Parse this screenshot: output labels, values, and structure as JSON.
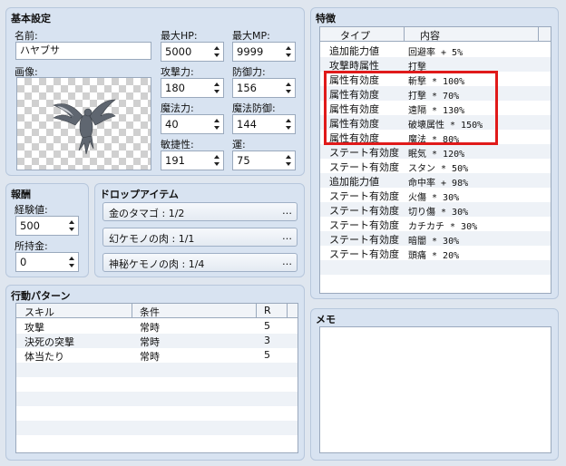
{
  "basic": {
    "title": "基本設定",
    "name_label": "名前:",
    "name_value": "ハヤブサ",
    "image_label": "画像:",
    "hp_label": "最大HP:",
    "hp_value": "5000",
    "mp_label": "最大MP:",
    "mp_value": "9999",
    "atk_label": "攻撃力:",
    "atk_value": "180",
    "def_label": "防御力:",
    "def_value": "156",
    "mat_label": "魔法力:",
    "mat_value": "40",
    "mdf_label": "魔法防御:",
    "mdf_value": "144",
    "agi_label": "敏捷性:",
    "agi_value": "191",
    "luk_label": "運:",
    "luk_value": "75"
  },
  "reward": {
    "title": "報酬",
    "exp_label": "経験値:",
    "exp_value": "500",
    "gold_label": "所持金:",
    "gold_value": "0"
  },
  "drops": {
    "title": "ドロップアイテム",
    "items": [
      "金のタマゴ : 1/2",
      "幻ケモノの肉 : 1/1",
      "神秘ケモノの肉 : 1/4"
    ],
    "button_glyph": "…"
  },
  "actions": {
    "title": "行動パターン",
    "headers": [
      "スキル",
      "条件",
      "R"
    ],
    "rows": [
      {
        "skill": "攻撃",
        "cond": "常時",
        "r": "5"
      },
      {
        "skill": "決死の突撃",
        "cond": "常時",
        "r": "3"
      },
      {
        "skill": "体当たり",
        "cond": "常時",
        "r": "5"
      }
    ]
  },
  "traits": {
    "title": "特徴",
    "headers": [
      "タイプ",
      "内容"
    ],
    "rows": [
      {
        "type": "追加能力値",
        "content": "回避率 + 5%"
      },
      {
        "type": "攻撃時属性",
        "content": "打撃"
      },
      {
        "type": "属性有効度",
        "content": "斬撃 * 100%"
      },
      {
        "type": "属性有効度",
        "content": "打撃 * 70%"
      },
      {
        "type": "属性有効度",
        "content": "遠隔 * 130%"
      },
      {
        "type": "属性有効度",
        "content": "破壊属性 * 150%"
      },
      {
        "type": "属性有効度",
        "content": "魔法 * 80%"
      },
      {
        "type": "ステート有効度",
        "content": "眠気 * 120%"
      },
      {
        "type": "ステート有効度",
        "content": "スタン * 50%"
      },
      {
        "type": "追加能力値",
        "content": "命中率 + 98%"
      },
      {
        "type": "ステート有効度",
        "content": "火傷 * 30%"
      },
      {
        "type": "ステート有効度",
        "content": "切り傷 * 30%"
      },
      {
        "type": "ステート有効度",
        "content": "カチカチ * 30%"
      },
      {
        "type": "ステート有効度",
        "content": "暗闇 * 30%"
      },
      {
        "type": "ステート有効度",
        "content": "頭痛 * 20%"
      }
    ]
  },
  "memo": {
    "title": "メモ",
    "value": ""
  }
}
